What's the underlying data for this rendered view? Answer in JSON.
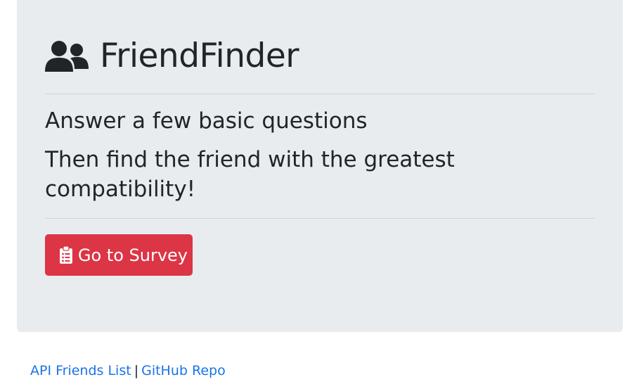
{
  "app": {
    "title": "FriendFinder",
    "title_icon": "users-icon"
  },
  "intro": {
    "line1": "Answer a few basic questions",
    "line2": "Then find the friend with the greatest compatibility!"
  },
  "survey_button": {
    "label": "Go to Survey",
    "icon": "clipboard-list-icon",
    "color": "#dc3545"
  },
  "footer": {
    "api_link": "API Friends List",
    "separator": "|",
    "github_link": "GitHub Repo",
    "link_color": "#1a73e8"
  },
  "colors": {
    "jumbotron_bg": "#e9ecef",
    "text": "#212529"
  }
}
